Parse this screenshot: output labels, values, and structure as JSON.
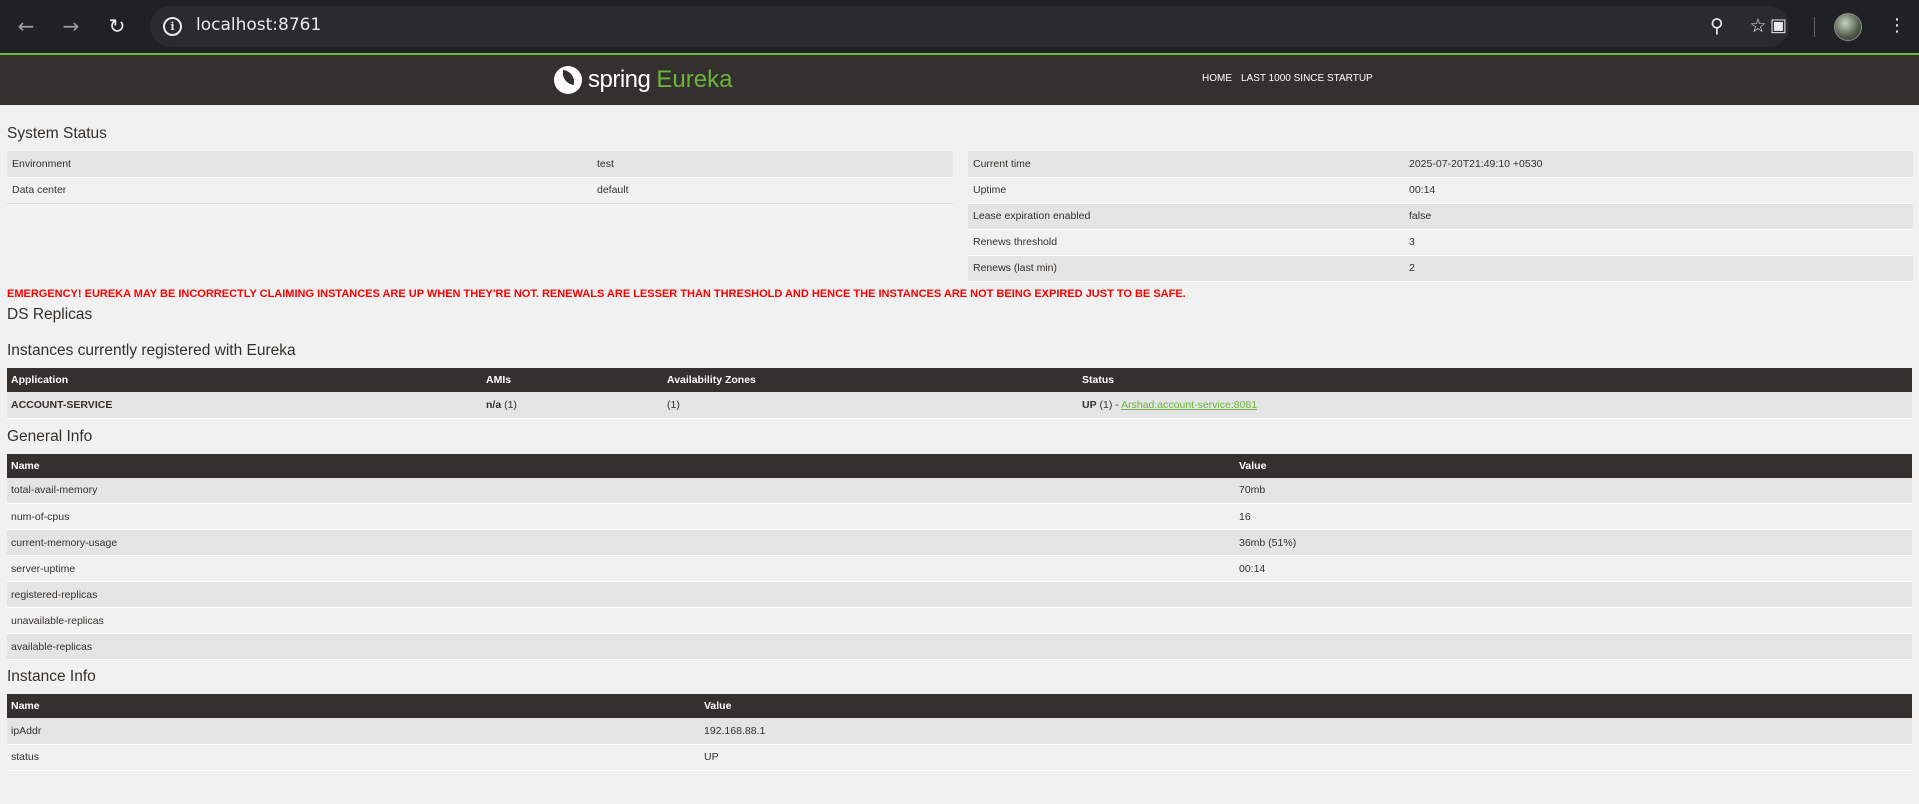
{
  "browser": {
    "url": "localhost:8761",
    "icons": [
      "back-arrow-icon",
      "forward-arrow-icon",
      "reload-icon",
      "site-info-icon",
      "zoom-icon",
      "bookmark-star-icon",
      "screenshot-lens-icon",
      "profile-avatar",
      "kebab-menu-icon"
    ]
  },
  "header": {
    "logo_spring": "spring",
    "logo_eureka": "Eureka",
    "nav": [
      "HOME",
      "LAST 1000 SINCE STARTUP"
    ]
  },
  "system_status": {
    "title": "System Status",
    "left": [
      {
        "name": "Environment",
        "value": "test"
      },
      {
        "name": "Data center",
        "value": "default"
      }
    ],
    "right": [
      {
        "name": "Current time",
        "value": "2025-07-20T21:49:10 +0530"
      },
      {
        "name": "Uptime",
        "value": "00:14"
      },
      {
        "name": "Lease expiration enabled",
        "value": "false"
      },
      {
        "name": "Renews threshold",
        "value": "3"
      },
      {
        "name": "Renews (last min)",
        "value": "2"
      }
    ]
  },
  "emergency": "EMERGENCY! EUREKA MAY BE INCORRECTLY CLAIMING INSTANCES ARE UP WHEN THEY'RE NOT. RENEWALS ARE LESSER THAN THRESHOLD AND HENCE THE INSTANCES ARE NOT BEING EXPIRED JUST TO BE SAFE.",
  "ds_replicas": {
    "title": "DS Replicas"
  },
  "instances": {
    "title": "Instances currently registered with Eureka",
    "headers": [
      "Application",
      "AMIs",
      "Availability Zones",
      "Status"
    ],
    "rows": [
      {
        "application": "ACCOUNT-SERVICE",
        "amis_bold": "n/a",
        "amis_count": " (1)",
        "zones": "(1)",
        "status_bold": "UP",
        "status_count": " (1) - ",
        "status_link": "Arshad:account-service:8081"
      }
    ]
  },
  "general_info": {
    "title": "General Info",
    "headers": [
      "Name",
      "Value"
    ],
    "rows": [
      {
        "name": "total-avail-memory",
        "value": "70mb"
      },
      {
        "name": "num-of-cpus",
        "value": "16"
      },
      {
        "name": "current-memory-usage",
        "value": "36mb (51%)"
      },
      {
        "name": "server-uptime",
        "value": "00:14"
      },
      {
        "name": "registered-replicas",
        "value": ""
      },
      {
        "name": "unavailable-replicas",
        "value": ""
      },
      {
        "name": "available-replicas",
        "value": ""
      }
    ]
  },
  "instance_info": {
    "title": "Instance Info",
    "headers": [
      "Name",
      "Value"
    ],
    "rows": [
      {
        "name": "ipAddr",
        "value": "192.168.88.1"
      },
      {
        "name": "status",
        "value": "UP"
      }
    ]
  },
  "colors": {
    "header_bg": "#34302d",
    "brand_green": "#6db33f",
    "emergency_red": "#ff0000"
  }
}
